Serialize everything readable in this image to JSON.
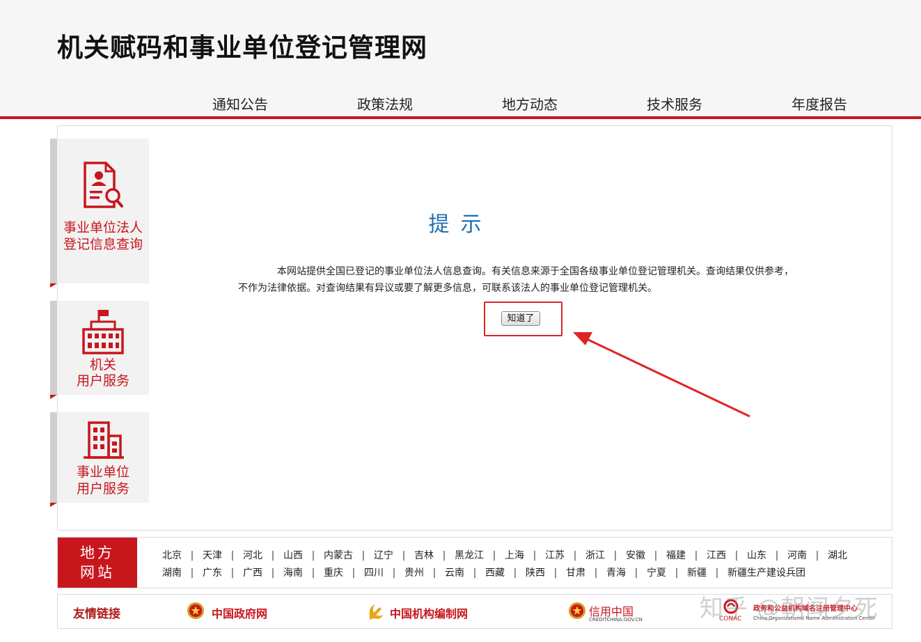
{
  "header": {
    "site_title": "机关赋码和事业单位登记管理网",
    "nav": [
      "通知公告",
      "政策法规",
      "地方动态",
      "技术服务",
      "年度报告"
    ]
  },
  "sidebar": {
    "items": [
      {
        "line1": "事业单位法人",
        "line2": "登记信息查询",
        "icon": "person-document-search-icon"
      },
      {
        "line1": "机关",
        "line2": "用户服务",
        "icon": "government-building-icon"
      },
      {
        "line1": "事业单位",
        "line2": "用户服务",
        "icon": "office-building-icon"
      }
    ]
  },
  "notice": {
    "title": "提示",
    "line1": "本网站提供全国已登记的事业单位法人信息查询。有关信息来源于全国各级事业单位登记管理机关。查询结果仅供参考，",
    "line2": "不作为法律依据。对查询结果有异议或要了解更多信息，可联系该法人的事业单位登记管理机关。",
    "button_label": "知道了"
  },
  "local_sites": {
    "heading_line1": "地方",
    "heading_line2": "网站",
    "row1": [
      "北京",
      "天津",
      "河北",
      "山西",
      "内蒙古",
      "辽宁",
      "吉林",
      "黑龙江",
      "上海",
      "江苏",
      "浙江",
      "安徽",
      "福建",
      "江西",
      "山东",
      "河南",
      "湖北"
    ],
    "row2": [
      "湖南",
      "广东",
      "广西",
      "海南",
      "重庆",
      "四川",
      "贵州",
      "云南",
      "西藏",
      "陕西",
      "甘肃",
      "青海",
      "宁夏",
      "新疆",
      "新疆生产建设兵团"
    ]
  },
  "friend_links": {
    "label": "友情链接",
    "items": [
      {
        "name": "中国政府网",
        "icon": "national-emblem-icon"
      },
      {
        "name": "中国机构编制网",
        "icon": "party-emblem-icon"
      },
      {
        "name": "信用中国",
        "sub": "CREDITCHINA.GOV.CN",
        "icon": "national-emblem-icon"
      },
      {
        "name": "政务和公益机构域名注册管理中心",
        "sub": "China Organizational Name Administration Center",
        "brand": "CONAC",
        "icon": "conac-logo-icon"
      }
    ]
  },
  "watermark": "知乎 @朝闻夕死",
  "colors": {
    "brand_red": "#c8161d",
    "title_blue": "#1f6fb2",
    "annotation_red": "#e02424",
    "header_bg": "#f6f6f6"
  }
}
